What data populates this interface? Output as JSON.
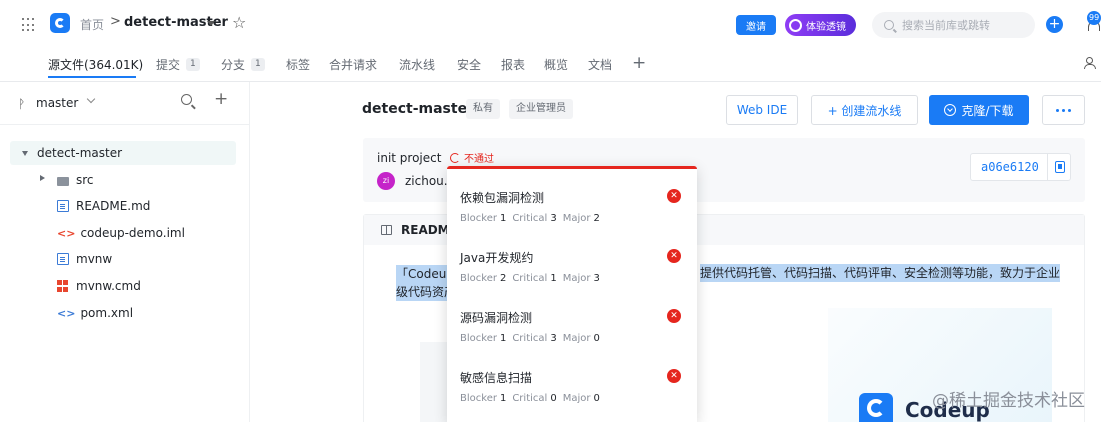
{
  "topbar": {
    "breadcrumb_home": "首页",
    "breadcrumb_sep": ">",
    "repo_name": "detect-master",
    "invite_label": "邀请",
    "trial_label": "体验透镜",
    "search_placeholder": "搜索当前库或跳转",
    "plus_label": "+",
    "notification_count": "99"
  },
  "tabs": [
    {
      "label": "源文件(364.01K)",
      "count": ""
    },
    {
      "label": "提交",
      "count": "1"
    },
    {
      "label": "分支",
      "count": "1"
    },
    {
      "label": "标签",
      "count": ""
    },
    {
      "label": "合并请求",
      "count": ""
    },
    {
      "label": "流水线",
      "count": ""
    },
    {
      "label": "安全",
      "count": ""
    },
    {
      "label": "报表",
      "count": ""
    },
    {
      "label": "概览",
      "count": ""
    },
    {
      "label": "文档",
      "count": ""
    }
  ],
  "sidebar": {
    "branch_icon": "ᚹ",
    "branch": "master",
    "plus_label": "+",
    "tree": {
      "root": "detect-master",
      "items": [
        "src",
        "README.md",
        "codeup-demo.iml",
        "mvnw",
        "mvnw.cmd",
        "pom.xml"
      ]
    }
  },
  "repo": {
    "title": "detect-master",
    "tags": [
      "私有",
      "企业管理员"
    ],
    "web_ide_label": "Web IDE",
    "create_pipeline_label": "+ 创建流水线",
    "clone_label": "克隆/下载"
  },
  "commit": {
    "message": "init project",
    "status": "不通过",
    "avatar_initials": "zi",
    "author": "zichou.zy",
    "hash": "a06e6120"
  },
  "readme": {
    "title": "README",
    "line1_start": "「Codeup",
    "line1_end": "提供代码托管、代码扫描、代码评审、安全检测等功能，致力于企业",
    "line2": "级代码资产"
  },
  "brand": {
    "name": "Codeup",
    "watermark": "@稀土掘金技术社区"
  },
  "checks": [
    {
      "name": "依赖包漏洞检测",
      "blocker": "1",
      "critical": "3",
      "major": "2"
    },
    {
      "name": "Java开发规约",
      "blocker": "2",
      "critical": "1",
      "major": "3"
    },
    {
      "name": "源码漏洞检测",
      "blocker": "1",
      "critical": "3",
      "major": "0"
    },
    {
      "name": "敏感信息扫描",
      "blocker": "1",
      "critical": "0",
      "major": "0"
    }
  ],
  "check_labels": {
    "blocker": "Blocker",
    "critical": "Critical",
    "major": "Major"
  },
  "colors": {
    "accent": "#1a7bf5",
    "fail": "#e5261e",
    "trial": "#7a34e8"
  }
}
